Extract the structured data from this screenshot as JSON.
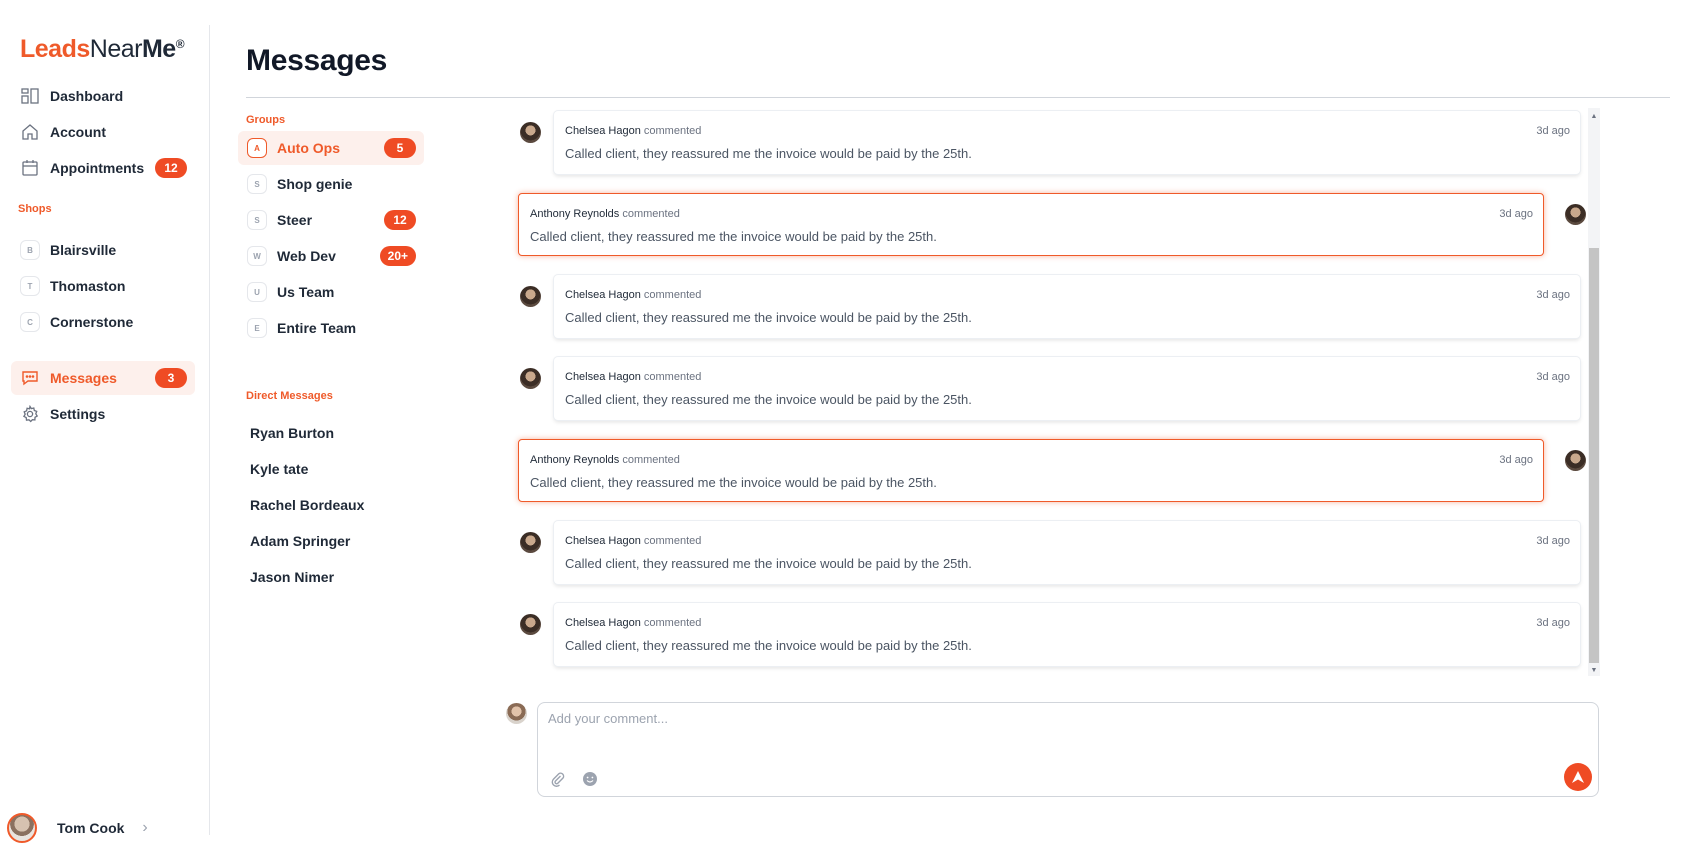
{
  "brand": {
    "leads": "Leads",
    "near": "Near",
    "me": "Me",
    "reg": "®"
  },
  "nav": [
    {
      "label": "Dashboard",
      "icon": "dashboard-icon"
    },
    {
      "label": "Account",
      "icon": "home-icon"
    },
    {
      "label": "Appointments",
      "icon": "calendar-icon",
      "badge": "12"
    }
  ],
  "shops_label": "Shops",
  "shops": [
    {
      "letter": "B",
      "label": "Blairsville"
    },
    {
      "letter": "T",
      "label": "Thomaston"
    },
    {
      "letter": "C",
      "label": "Cornerstone"
    }
  ],
  "nav_bottom": [
    {
      "label": "Messages",
      "icon": "chat-icon",
      "badge": "3",
      "active": true
    },
    {
      "label": "Settings",
      "icon": "gear-icon"
    }
  ],
  "user": {
    "name": "Tom Cook"
  },
  "page_title": "Messages",
  "groups_label": "Groups",
  "groups": [
    {
      "letter": "A",
      "label": "Auto Ops",
      "badge": "5",
      "active": true
    },
    {
      "letter": "S",
      "label": "Shop genie"
    },
    {
      "letter": "S",
      "label": "Steer",
      "badge": "12"
    },
    {
      "letter": "W",
      "label": "Web Dev",
      "badge": "20+"
    },
    {
      "letter": "U",
      "label": "Us Team"
    },
    {
      "letter": "E",
      "label": "Entire Team"
    }
  ],
  "dm_label": "Direct Messages",
  "direct_messages": [
    "Ryan Burton",
    "Kyle tate",
    "Rachel Bordeaux",
    "Adam Springer",
    "Jason Nimer"
  ],
  "messages": [
    {
      "author": "Chelsea Hagon",
      "action": "commented",
      "time": "3d ago",
      "text": "Called client, they reassured me the invoice would be paid by the 25th.",
      "self": false
    },
    {
      "author": "Anthony Reynolds",
      "action": "commented",
      "time": "3d ago",
      "text": "Called client, they reassured me the invoice would be paid by the 25th.",
      "self": true
    },
    {
      "author": "Chelsea Hagon",
      "action": "commented",
      "time": "3d ago",
      "text": "Called client, they reassured me the invoice would be paid by the 25th.",
      "self": false
    },
    {
      "author": "Chelsea Hagon",
      "action": "commented",
      "time": "3d ago",
      "text": "Called client, they reassured me the invoice would be paid by the 25th.",
      "self": false
    },
    {
      "author": "Anthony Reynolds",
      "action": "commented",
      "time": "3d ago",
      "text": "Called client, they reassured me the invoice would be paid by the 25th.",
      "self": true
    },
    {
      "author": "Chelsea Hagon",
      "action": "commented",
      "time": "3d ago",
      "text": "Called client, they reassured me the invoice would be paid by the 25th.",
      "self": false
    },
    {
      "author": "Chelsea Hagon",
      "action": "commented",
      "time": "3d ago",
      "text": "Called client, they reassured me the invoice would be paid by the 25th.",
      "self": false
    }
  ],
  "composer": {
    "placeholder": "Add your comment..."
  },
  "colors": {
    "accent": "#ef5a2a",
    "badge": "#ef4b24",
    "active_bg": "#fdf0ec"
  }
}
